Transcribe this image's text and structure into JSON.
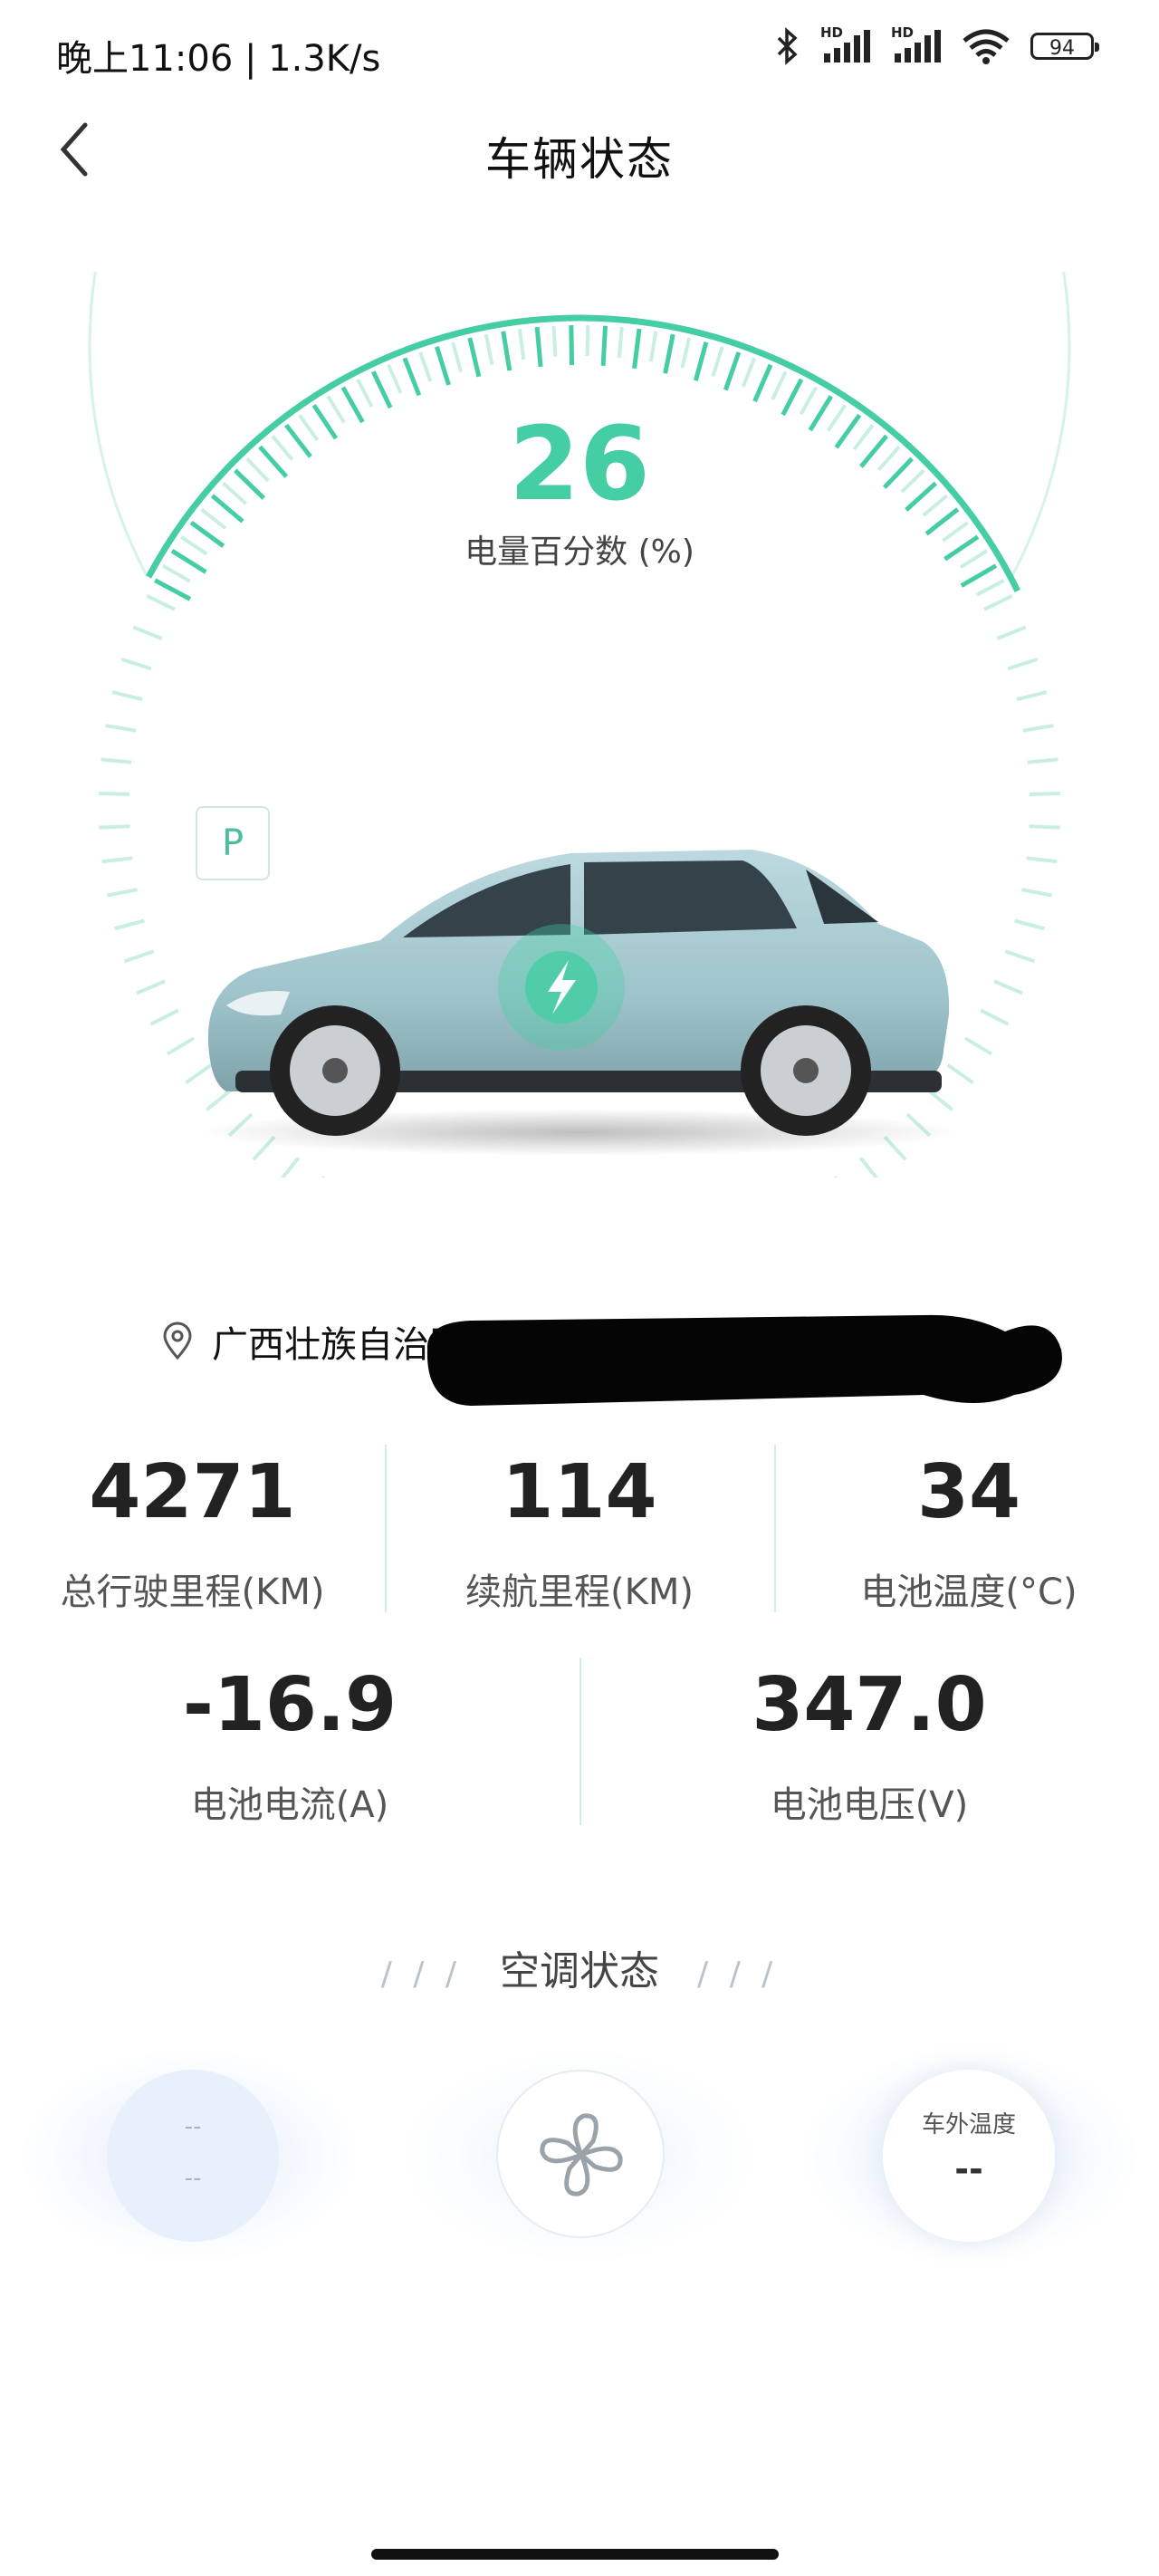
{
  "status_bar": {
    "time_text": "晚上11:06 | 1.3K/s",
    "battery_level": "94",
    "network_badges": [
      "HD",
      "HD"
    ]
  },
  "header": {
    "back_icon": "chevron-left-icon",
    "title": "车辆状态"
  },
  "battery_gauge": {
    "percent": "26",
    "label": "电量百分数 (%)",
    "fill_fraction": 0.26,
    "gear": "P",
    "accent_color": "#45cda4"
  },
  "location": {
    "icon": "location-pin-icon",
    "text": "广西壮族自治区"
  },
  "stats_row1": [
    {
      "value": "4271",
      "label": "总行驶里程(KM)"
    },
    {
      "value": "114",
      "label": "续航里程(KM)"
    },
    {
      "value": "34",
      "label": "电池温度(°C)"
    }
  ],
  "stats_row2": [
    {
      "value": "-16.9",
      "label": "电池电流(A)"
    },
    {
      "value": "347.0",
      "label": "电池电压(V)"
    }
  ],
  "ac": {
    "title": "空调状态",
    "left_top": "--",
    "left_bottom": "--",
    "fan_icon": "fan-icon",
    "outside_temp_label": "车外温度",
    "outside_temp_value": "--"
  }
}
